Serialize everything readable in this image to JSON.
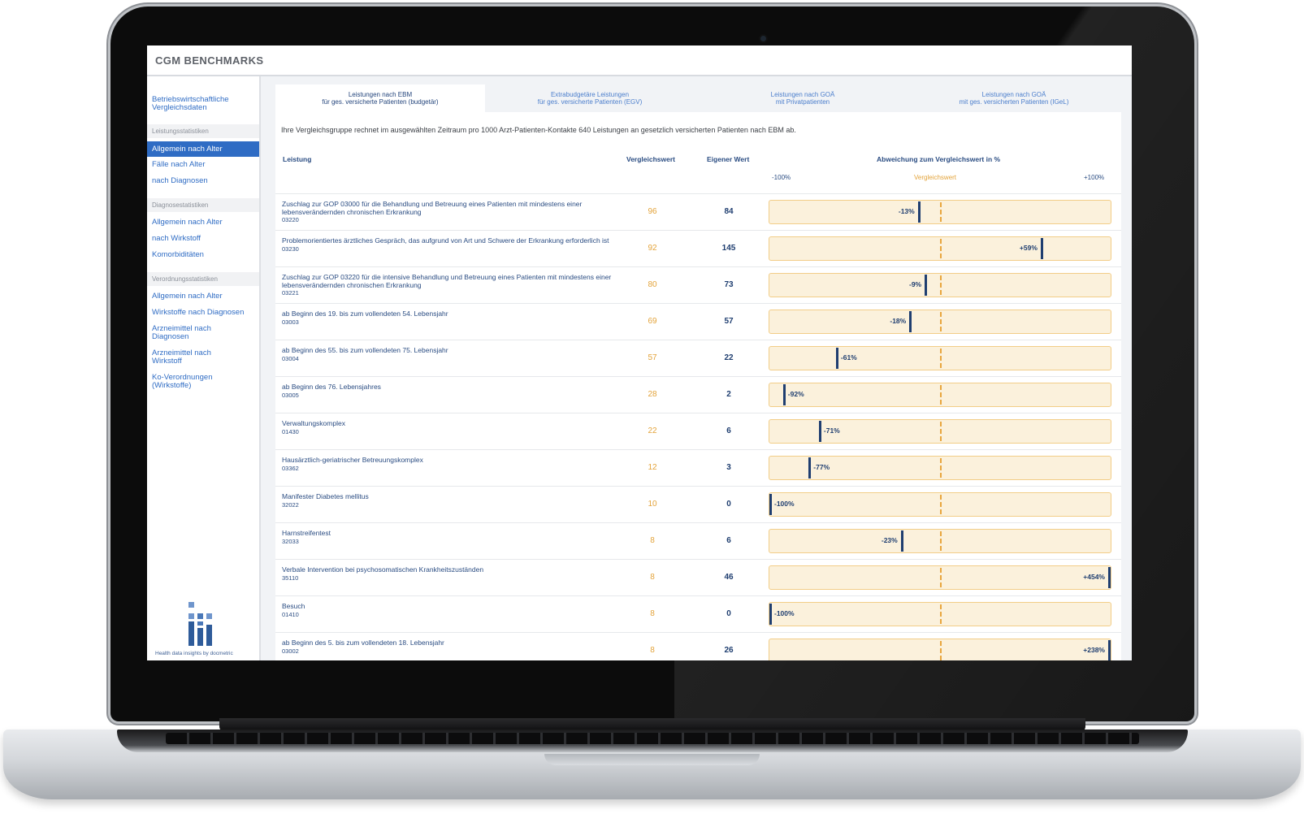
{
  "app": {
    "title": "CGM BENCHMARKS"
  },
  "sidebar": {
    "top_link": "Betriebswirtschaftliche Vergleichsdaten",
    "sections": [
      {
        "heading": "Leistungsstatistiken",
        "items": [
          "Allgemein nach Alter",
          "Fälle nach Alter",
          "nach Diagnosen"
        ]
      },
      {
        "heading": "Diagnosestatistiken",
        "items": [
          "Allgemein nach Alter",
          "nach Wirkstoff",
          "Komorbiditäten"
        ]
      },
      {
        "heading": "Verordnungsstatistiken",
        "items": [
          "Allgemein nach Alter",
          "Wirkstoffe nach Diagnosen",
          "Arzneimittel nach Diagnosen",
          "Arzneimittel nach Wirkstoff",
          "Ko-Verordnungen (Wirkstoffe)"
        ]
      }
    ],
    "active_item": "Allgemein nach Alter",
    "brand_text": "Health data insights by docmetric"
  },
  "tabs": [
    {
      "line1": "Leistungen nach EBM",
      "line2": "für ges. versicherte Patienten (budgetär)",
      "active": true
    },
    {
      "line1": "Extrabudgetäre Leistungen",
      "line2": "für ges. versicherte Patienten (EGV)",
      "active": false
    },
    {
      "line1": "Leistungen nach GOÄ",
      "line2": "mit Privatpatienten",
      "active": false
    },
    {
      "line1": "Leistungen nach GOÄ",
      "line2": "mit ges. versicherten Patienten (IGeL)",
      "active": false
    }
  ],
  "intro": "Ihre Vergleichsgruppe rechnet im ausgewählten Zeitraum pro 1000 Arzt-Patienten-Kontakte 640 Leistungen an gesetzlich versicherten Patienten nach EBM ab.",
  "table": {
    "col_leistung": "Leistung",
    "col_vergleich": "Vergleichswert",
    "col_eigener": "Eigener Wert",
    "col_abweichung": "Abweichung zum Vergleichswert in %",
    "scale_min": "-100%",
    "scale_mid": "Vergleichswert",
    "scale_max": "+100%",
    "colors": {
      "reference": "#e3a33a",
      "own": "#1f3e70",
      "bar_bg": "#fbf1dc",
      "link": "#2f6cc4"
    },
    "rows": [
      {
        "name": "Zuschlag zur GOP 03000 für die Behandlung und Betreuung eines Patienten mit mindestens einer lebensverändernden chronischen Erkrankung",
        "code": "03220",
        "ref": "96",
        "own": "84",
        "deviation": -13,
        "label": "-13%"
      },
      {
        "name": "Problemorientiertes ärztliches Gespräch, das aufgrund von Art und Schwere der Erkrankung erforderlich ist",
        "code": "03230",
        "ref": "92",
        "own": "145",
        "deviation": 59,
        "label": "+59%"
      },
      {
        "name": "Zuschlag zur GOP 03220 für die intensive Behandlung und Betreuung eines Patienten mit mindestens einer lebensverändernden chronischen Erkrankung",
        "code": "03221",
        "ref": "80",
        "own": "73",
        "deviation": -9,
        "label": "-9%"
      },
      {
        "name": "ab Beginn des 19. bis zum vollendeten 54. Lebensjahr",
        "code": "03003",
        "ref": "69",
        "own": "57",
        "deviation": -18,
        "label": "-18%"
      },
      {
        "name": "ab Beginn des 55. bis zum vollendeten 75. Lebensjahr",
        "code": "03004",
        "ref": "57",
        "own": "22",
        "deviation": -61,
        "label": "-61%"
      },
      {
        "name": "ab Beginn des 76. Lebensjahres",
        "code": "03005",
        "ref": "28",
        "own": "2",
        "deviation": -92,
        "label": "-92%"
      },
      {
        "name": "Verwaltungskomplex",
        "code": "01430",
        "ref": "22",
        "own": "6",
        "deviation": -71,
        "label": "-71%"
      },
      {
        "name": "Hausärztlich-geriatrischer Betreuungskomplex",
        "code": "03362",
        "ref": "12",
        "own": "3",
        "deviation": -77,
        "label": "-77%"
      },
      {
        "name": "Manifester Diabetes mellitus",
        "code": "32022",
        "ref": "10",
        "own": "0",
        "deviation": -100,
        "label": "-100%"
      },
      {
        "name": "Harnstreifentest",
        "code": "32033",
        "ref": "8",
        "own": "6",
        "deviation": -23,
        "label": "-23%"
      },
      {
        "name": "Verbale Intervention bei psychosomatischen Krankheitszuständen",
        "code": "35110",
        "ref": "8",
        "own": "46",
        "deviation": 454,
        "label": "+454%"
      },
      {
        "name": "Besuch",
        "code": "01410",
        "ref": "8",
        "own": "0",
        "deviation": -100,
        "label": "-100%"
      },
      {
        "name": "ab Beginn des 5. bis zum vollendeten 18. Lebensjahr",
        "code": "03002",
        "ref": "8",
        "own": "26",
        "deviation": 238,
        "label": "+238%"
      }
    ]
  }
}
